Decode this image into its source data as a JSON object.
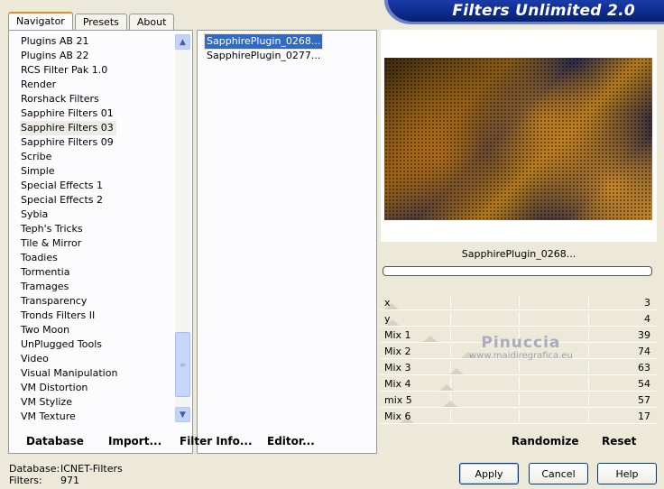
{
  "window": {
    "title": "Filters Unlimited 2.0"
  },
  "tabs": [
    {
      "label": "Navigator",
      "active": true
    },
    {
      "label": "Presets",
      "active": false
    },
    {
      "label": "About",
      "active": false
    }
  ],
  "navigator": {
    "items": [
      "Plugins AB 21",
      "Plugins AB 22",
      "RCS Filter Pak 1.0",
      "Render",
      "Rorshack Filters",
      "Sapphire Filters 01",
      "Sapphire Filters 03",
      "Sapphire Filters 09",
      "Scribe",
      "Simple",
      "Special Effects 1",
      "Special Effects 2",
      "Sybia",
      "Teph's Tricks",
      "Tile & Mirror",
      "Toadies",
      "Tormentia",
      "Tramages",
      "Transparency",
      "Tronds Filters II",
      "Two Moon",
      "UnPlugged Tools",
      "Video",
      "Visual Manipulation",
      "VM Distortion",
      "VM Stylize",
      "VM Texture"
    ],
    "selected_index": 6,
    "buttons": {
      "database": "Database",
      "import": "Import...",
      "filter_info": "Filter Info...",
      "editor": "Editor..."
    }
  },
  "filters": {
    "items": [
      "SapphirePlugin_0268...",
      "SapphirePlugin_0277..."
    ],
    "selected_index": 0
  },
  "preview": {
    "filter_name": "SapphirePlugin_0268...",
    "params": [
      {
        "label": "x",
        "value": "3",
        "fraction": 0.012
      },
      {
        "label": "y",
        "value": "4",
        "fraction": 0.016
      },
      {
        "label": "Mix 1",
        "value": "39",
        "fraction": 0.153
      },
      {
        "label": "Mix 2",
        "value": "74",
        "fraction": 0.29
      },
      {
        "label": "Mix 3",
        "value": "63",
        "fraction": 0.247
      },
      {
        "label": "Mix 4",
        "value": "54",
        "fraction": 0.212
      },
      {
        "label": "mix 5",
        "value": "57",
        "fraction": 0.224
      },
      {
        "label": "Mix 6",
        "value": "17",
        "fraction": 0.067
      }
    ],
    "watermark": {
      "main": "Pinuccia",
      "sub": "www.maidiregrafica.eu"
    },
    "buttons": {
      "randomize": "Randomize",
      "reset": "Reset"
    }
  },
  "status": {
    "database_label": "Database:",
    "database_value": "ICNET-Filters",
    "filters_label": "Filters:",
    "filters_value": "971"
  },
  "dialog_buttons": {
    "apply": "Apply",
    "cancel": "Cancel",
    "help": "Help"
  },
  "colors": {
    "banner": "#0c2a8c",
    "selection": "#316ac5",
    "tab_accent": "#e68b2c"
  }
}
